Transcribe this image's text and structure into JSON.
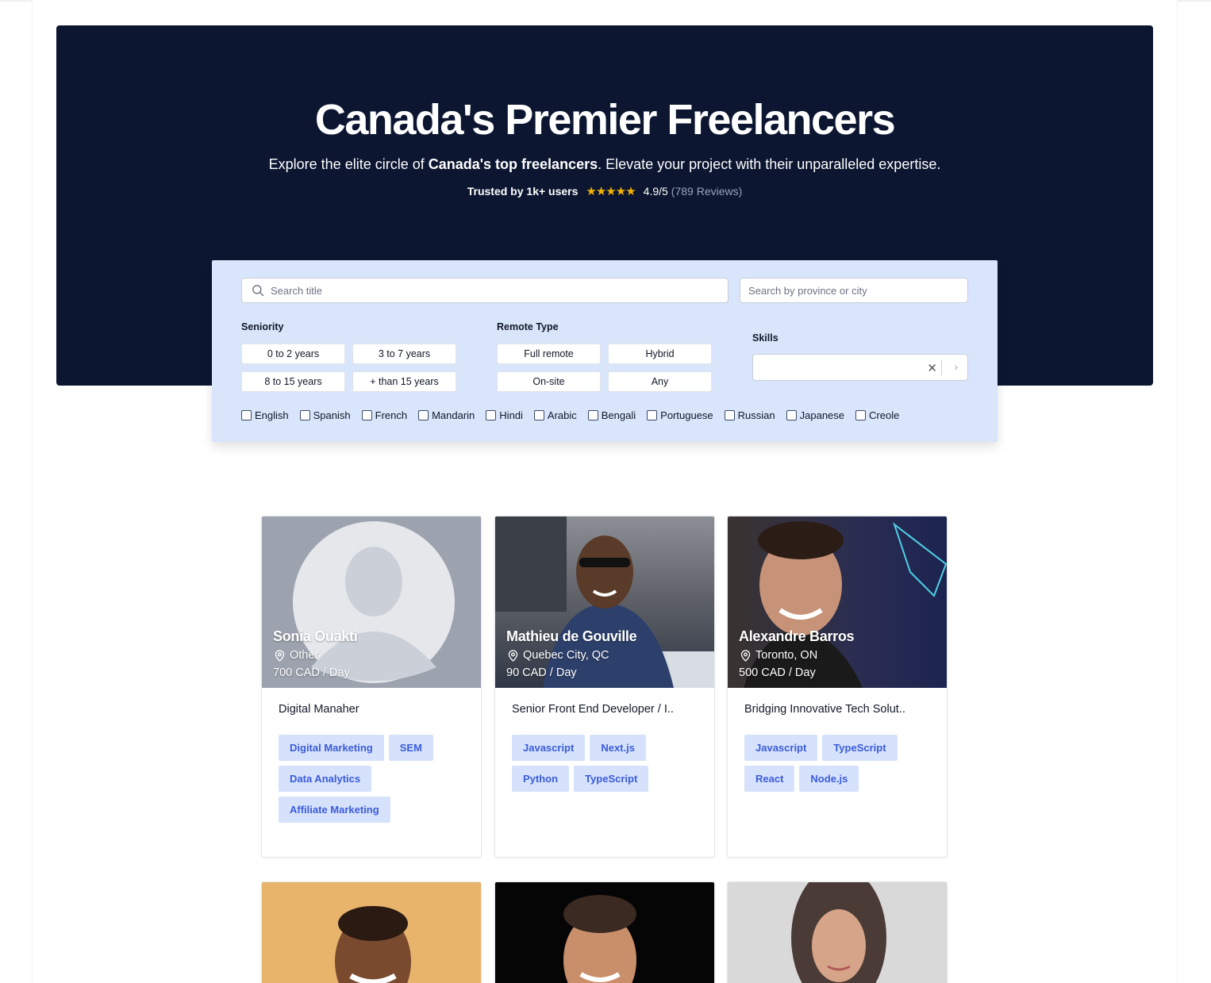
{
  "hero": {
    "title": "Canada's Premier Freelancers",
    "subtitle_pre": "Explore the elite circle of ",
    "subtitle_bold": "Canada's top freelancers",
    "subtitle_post": ". Elevate your project with their unparalleled expertise.",
    "trusted": "Trusted by 1k+ users",
    "stars": "★★★★★",
    "rating": "4.9/5",
    "reviews": "(789 Reviews)"
  },
  "filters": {
    "search_placeholder": "Search title",
    "location_placeholder": "Search by province or city",
    "seniority_label": "Seniority",
    "seniority": [
      "0 to 2 years",
      "3 to 7 years",
      "8 to 15 years",
      "+ than 15 years"
    ],
    "remote_label": "Remote Type",
    "remote": [
      "Full remote",
      "Hybrid",
      "On-site",
      "Any"
    ],
    "skills_label": "Skills",
    "skills_clear": "✕",
    "skills_arrow": "›",
    "languages": [
      "English",
      "Spanish",
      "French",
      "Mandarin",
      "Hindi",
      "Arabic",
      "Bengali",
      "Portuguese",
      "Russian",
      "Japanese",
      "Creole"
    ]
  },
  "cards": [
    {
      "name": "Sonia Ouakti",
      "location": "Other",
      "rate": "700 CAD / Day",
      "title": "Digital Manaher",
      "tags": [
        "Digital Marketing",
        "SEM",
        "Data Analytics",
        "Affiliate Marketing"
      ]
    },
    {
      "name": "Mathieu de Gouville",
      "location": "Quebec City, QC",
      "rate": "90 CAD / Day",
      "title": "Senior Front End Developer / I..",
      "tags": [
        "Javascript",
        "Next.js",
        "Python",
        "TypeScript"
      ]
    },
    {
      "name": "Alexandre Barros",
      "location": "Toronto, ON",
      "rate": "500 CAD / Day",
      "title": "Bridging Innovative Tech Solut..",
      "tags": [
        "Javascript",
        "TypeScript",
        "React",
        "Node.js"
      ]
    }
  ],
  "colors": {
    "hero_bg": "#0c1631",
    "filter_bg": "#d9e5fb",
    "tag_bg": "#d6e2fc",
    "tag_text": "#3a5bd9",
    "star": "#f5b301"
  }
}
